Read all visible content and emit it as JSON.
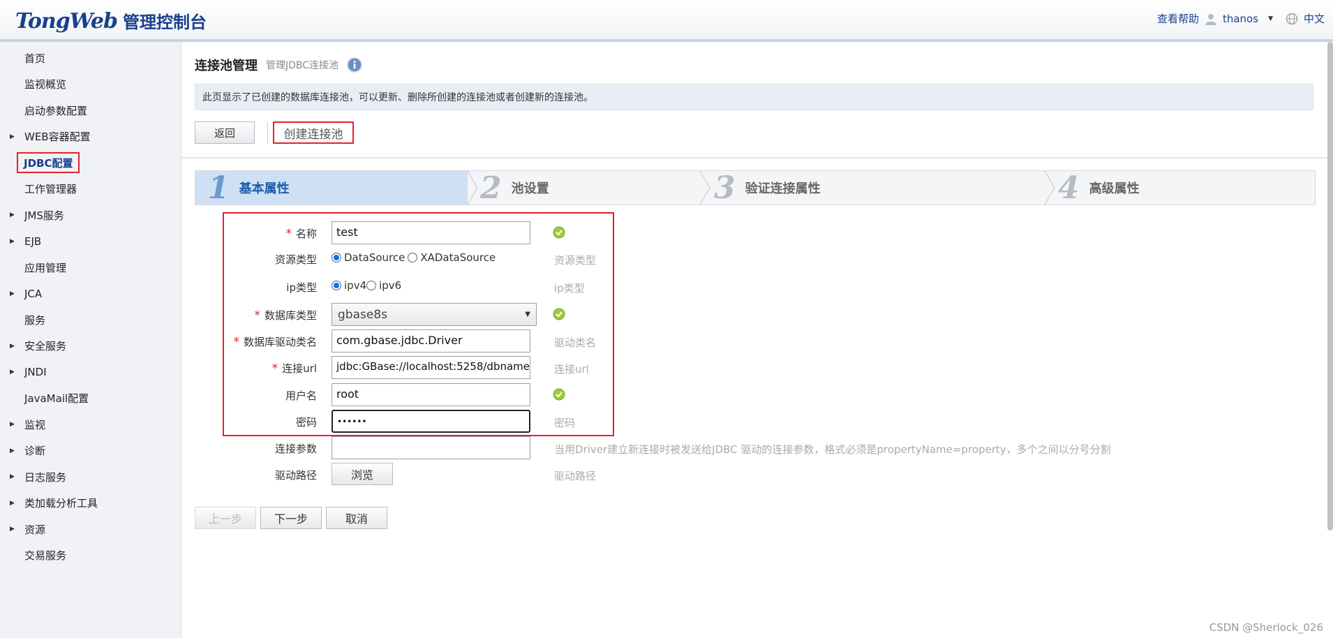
{
  "header": {
    "logo_tong": "Tong",
    "logo_web": "Web",
    "logo_sub": "管理控制台",
    "help": "查看帮助",
    "user": "thanos",
    "language": "中文"
  },
  "sidebar": {
    "items": [
      {
        "label": "首页",
        "expandable": false,
        "active": false
      },
      {
        "label": "监视概览",
        "expandable": false,
        "active": false
      },
      {
        "label": "启动参数配置",
        "expandable": false,
        "active": false
      },
      {
        "label": "WEB容器配置",
        "expandable": true,
        "active": false
      },
      {
        "label": "JDBC配置",
        "expandable": false,
        "active": true
      },
      {
        "label": "工作管理器",
        "expandable": false,
        "active": false
      },
      {
        "label": "JMS服务",
        "expandable": true,
        "active": false
      },
      {
        "label": "EJB",
        "expandable": true,
        "active": false
      },
      {
        "label": "应用管理",
        "expandable": false,
        "active": false
      },
      {
        "label": "JCA",
        "expandable": true,
        "active": false
      },
      {
        "label": "服务",
        "expandable": false,
        "active": false
      },
      {
        "label": "安全服务",
        "expandable": true,
        "active": false
      },
      {
        "label": "JNDI",
        "expandable": true,
        "active": false
      },
      {
        "label": "JavaMail配置",
        "expandable": false,
        "active": false
      },
      {
        "label": "监视",
        "expandable": true,
        "active": false
      },
      {
        "label": "诊断",
        "expandable": true,
        "active": false
      },
      {
        "label": "日志服务",
        "expandable": true,
        "active": false
      },
      {
        "label": "类加载分析工具",
        "expandable": true,
        "active": false
      },
      {
        "label": "资源",
        "expandable": true,
        "active": false
      },
      {
        "label": "交易服务",
        "expandable": false,
        "active": false
      }
    ]
  },
  "main": {
    "title": "连接池管理",
    "subtitle": "管理JDBC连接池",
    "description": "此页显示了已创建的数据库连接池，可以更新、删除所创建的连接池或者创建新的连接池。",
    "back_label": "返回",
    "create_tab": "创建连接池",
    "steps": [
      {
        "num": "1",
        "name": "基本属性",
        "active": true
      },
      {
        "num": "2",
        "name": "池设置",
        "active": false
      },
      {
        "num": "3",
        "name": "验证连接属性",
        "active": false
      },
      {
        "num": "4",
        "name": "高级属性",
        "active": false
      }
    ],
    "form": {
      "name": {
        "label": "名称",
        "required": true,
        "value": "test",
        "valid": true
      },
      "resource_type": {
        "label": "资源类型",
        "option1": "DataSource",
        "option2": "XADataSource",
        "selected": "DataSource",
        "hint": "资源类型"
      },
      "ip_type": {
        "label": "ip类型",
        "option1": "ipv4",
        "option2": "ipv6",
        "selected": "ipv4",
        "hint": "ip类型"
      },
      "db_type": {
        "label": "数据库类型",
        "required": true,
        "value": "gbase8s",
        "valid": true
      },
      "driver_class": {
        "label": "数据库驱动类名",
        "required": true,
        "value": "com.gbase.jdbc.Driver",
        "hint": "驱动类名"
      },
      "url": {
        "label": "连接url",
        "required": true,
        "value": "jdbc:GBase://localhost:5258/dbname",
        "hint": "连接url"
      },
      "username": {
        "label": "用户名",
        "value": "root",
        "valid": true
      },
      "password": {
        "label": "密码",
        "value": "••••••",
        "hint": "密码"
      },
      "conn_params": {
        "label": "连接参数",
        "value": "",
        "hint": "当用Driver建立新连接时被发送给JDBC 驱动的连接参数，格式必须是propertyName=property，多个之间以分号分割"
      },
      "driver_path": {
        "label": "驱动路径",
        "browse": "浏览",
        "hint": "驱动路径"
      }
    },
    "buttons": {
      "prev": "上一步",
      "next": "下一步",
      "cancel": "取消"
    }
  },
  "watermark": "CSDN @Sherlock_026",
  "colors": {
    "accent": "#1a3f8c",
    "highlight": "#e0242a",
    "step_active": "#cfe0f4"
  }
}
